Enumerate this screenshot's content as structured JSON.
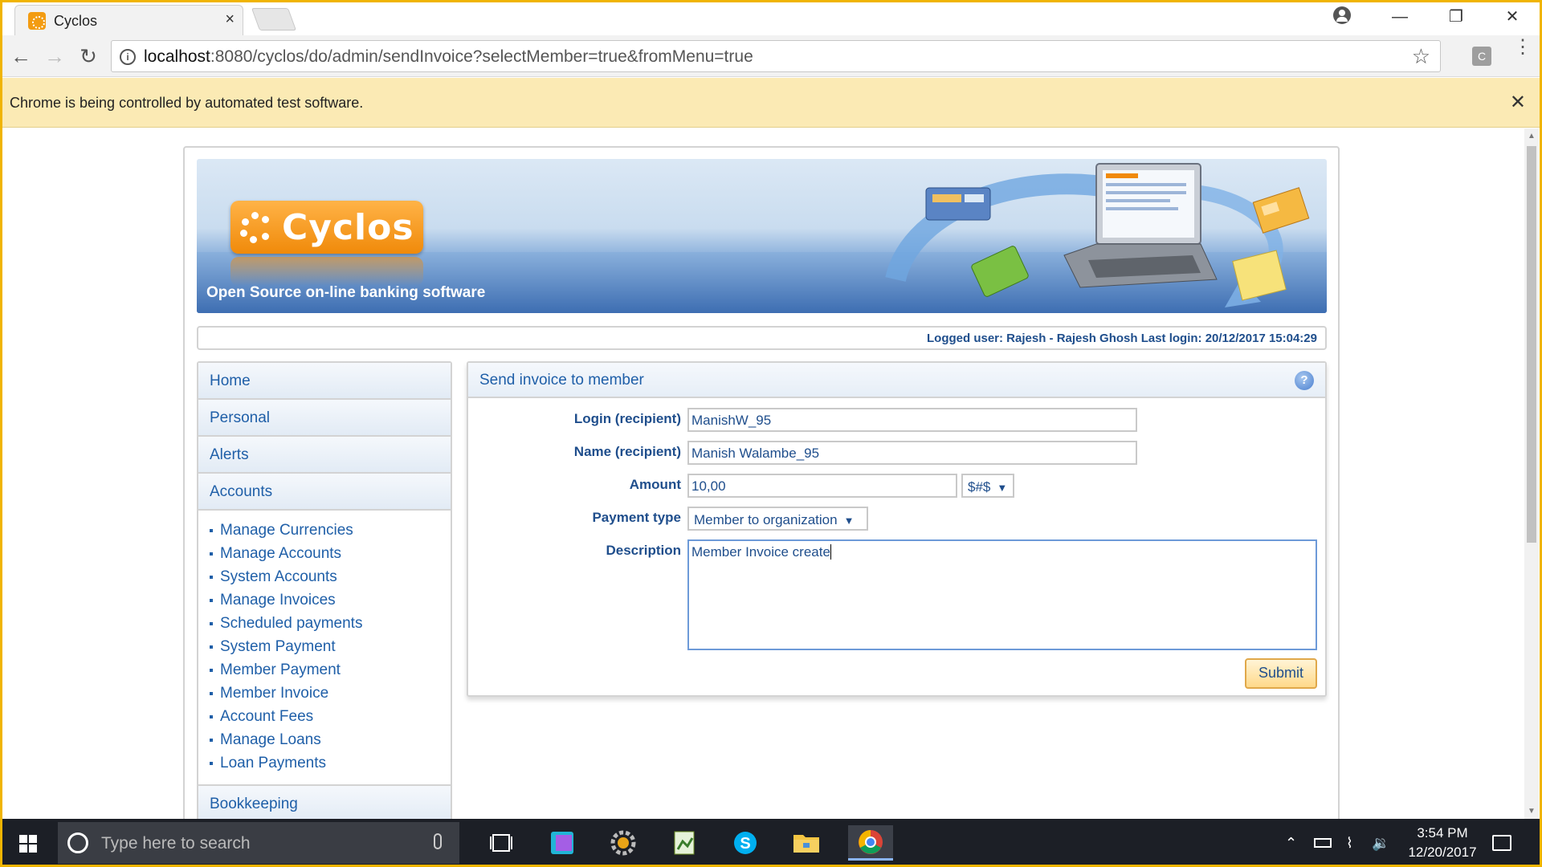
{
  "browser": {
    "tab_title": "Cyclos",
    "tab_close": "×",
    "url_host": "localhost",
    "url_path": ":8080/cyclos/do/admin/sendInvoice?selectMember=true&fromMenu=true",
    "infobar_text": "Chrome is being controlled by automated test software.",
    "infobar_close": "✕",
    "window_controls": {
      "minimize": "—",
      "restore": "❐",
      "close": "✕"
    },
    "extension_label": "C"
  },
  "banner": {
    "logo_text": "Cyclos",
    "tagline": "Open Source on-line banking software"
  },
  "session": {
    "logged_text": "Logged user: Rajesh - Rajesh Ghosh   Last login: 20/12/2017 15:04:29"
  },
  "sidebar": {
    "items": [
      {
        "label": "Home"
      },
      {
        "label": "Personal"
      },
      {
        "label": "Alerts"
      },
      {
        "label": "Accounts"
      }
    ],
    "accounts_submenu": [
      "Manage Currencies",
      "Manage Accounts",
      "System Accounts",
      "Manage Invoices",
      "Scheduled payments",
      "System Payment",
      "Member Payment",
      "Member Invoice",
      "Account Fees",
      "Manage Loans",
      "Loan Payments"
    ],
    "bookkeeping": "Bookkeeping"
  },
  "form": {
    "title": "Send invoice to member",
    "help_icon": "?",
    "login_label": "Login (recipient)",
    "login_value": "ManishW_95",
    "name_label": "Name (recipient)",
    "name_value": "Manish Walambe_95",
    "amount_label": "Amount",
    "amount_value": "10,00",
    "currency_value": "$#$",
    "payment_type_label": "Payment type",
    "payment_type_value": "Member to organization",
    "description_label": "Description",
    "description_value": "Member Invoice create",
    "submit_label": "Submit"
  },
  "taskbar": {
    "search_placeholder": "Type here to search",
    "time": "3:54 PM",
    "date": "12/20/2017"
  },
  "colors": {
    "link_blue": "#1f5fa8",
    "label_blue": "#1f4e8c",
    "infobar": "#fbeab4",
    "window_border": "#f0b400",
    "accent_orange": "#f08a0a"
  }
}
